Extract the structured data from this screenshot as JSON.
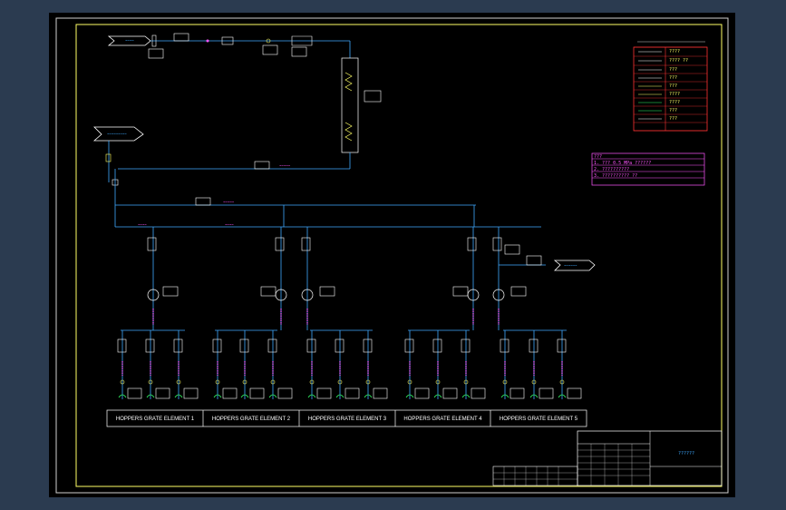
{
  "hoppers": [
    {
      "label": "HOPPERS GRATE ELEMENT 1"
    },
    {
      "label": "HOPPERS GRATE ELEMENT 2"
    },
    {
      "label": "HOPPERS GRATE ELEMENT 3"
    },
    {
      "label": "HOPPERS GRATE ELEMENT 4"
    },
    {
      "label": "HOPPERS GRATE ELEMENT 5"
    }
  ],
  "legend": {
    "rows": [
      "????",
      "???? ??",
      "???",
      "???",
      "???",
      "????",
      "????",
      "???",
      "???"
    ]
  },
  "notes": {
    "lines": [
      "???",
      "1. ??? 0.5 MPa ??????",
      "2. ??????????",
      "3. ?????????? ??"
    ]
  },
  "title_block": {
    "title": "??????"
  },
  "colors": {
    "background": "#000000",
    "frame": "#ffff66",
    "pipe": "#3fa9ff",
    "magenta": "#ff55ff",
    "green": "#33ff66",
    "red": "#ff3333",
    "white": "#ffffff",
    "yellow": "#ffff66"
  }
}
